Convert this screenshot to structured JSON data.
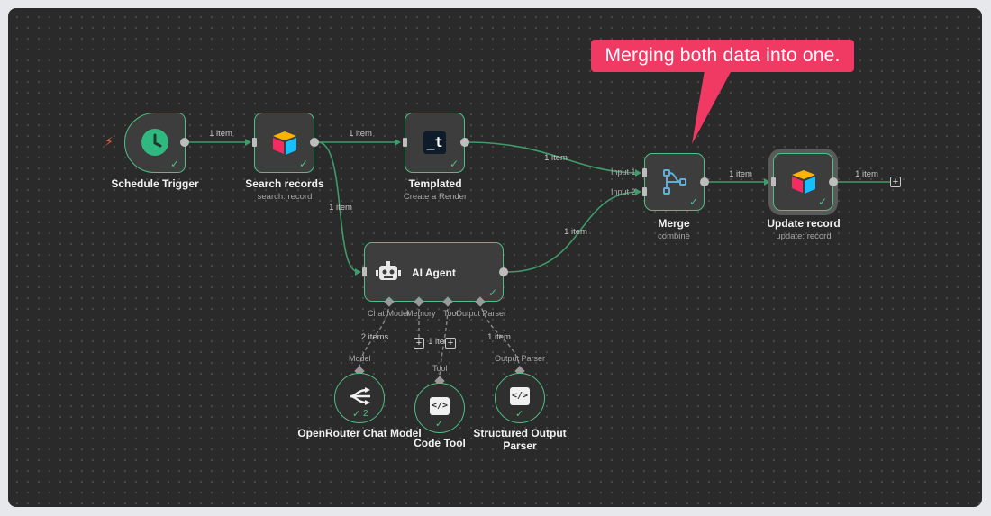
{
  "callout": {
    "text": "Merging both data into one."
  },
  "nodes": {
    "schedule_trigger": {
      "title": "Schedule Trigger",
      "icon": "clock-icon"
    },
    "search_records": {
      "title": "Search records",
      "subtitle": "search: record",
      "icon": "airtable-icon"
    },
    "templated": {
      "title": "Templated",
      "subtitle": "Create a Render",
      "icon": "templated-icon",
      "icon_text": "_t"
    },
    "merge": {
      "title": "Merge",
      "subtitle": "combine",
      "icon": "merge-icon",
      "input1": "Input 1",
      "input2": "Input 2"
    },
    "update_record": {
      "title": "Update record",
      "subtitle": "update: record",
      "icon": "airtable-icon"
    },
    "ai_agent": {
      "title": "AI Agent",
      "icon": "robot-icon",
      "ports": {
        "chat_model": "Chat Model",
        "memory": "Memory",
        "tool": "Tool",
        "output_parser": "Output Parser"
      }
    },
    "openrouter": {
      "title": "OpenRouter Chat Model",
      "port_label": "Model",
      "icon": "openrouter-icon",
      "run_count": "2"
    },
    "code_tool": {
      "title": "Code Tool",
      "port_label": "Tool",
      "icon": "code-icon",
      "icon_text": "</>"
    },
    "structured_parser": {
      "title": "Structured Output Parser",
      "port_label": "Output Parser",
      "icon": "code-icon",
      "icon_text": "</>"
    }
  },
  "edges": {
    "trigger_to_search": "1 item",
    "search_to_templated": "1 item",
    "search_to_agent": "1 item",
    "templated_to_merge": "1 item",
    "agent_to_merge": "1 item",
    "merge_to_update": "1 item",
    "update_out": "1 item",
    "model_to_agent": "2 items",
    "tool_to_agent": "1 item",
    "parser_to_agent": "1 item"
  },
  "colors": {
    "node_border": "#4fbf83",
    "edge": "#3e9c6a",
    "callout": "#f03a64",
    "canvas": "#2a2a2a"
  }
}
